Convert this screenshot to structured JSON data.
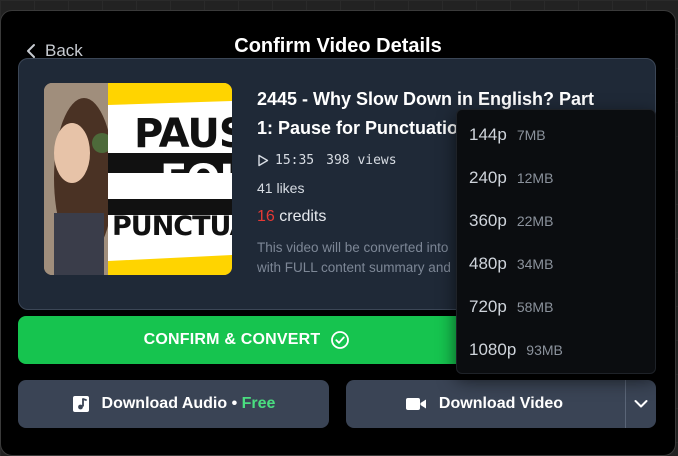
{
  "header": {
    "back_label": "Back",
    "title": "Confirm Video Details"
  },
  "video": {
    "title_line1": "2445 - Why Slow Down in English? Part",
    "title_line2": "1: Pause for Punctuatio",
    "duration": "15:35",
    "views": "398 views",
    "likes": "41 likes",
    "credits_num": "16",
    "credits_label": "credits",
    "desc_line1": "This video will be converted into",
    "desc_line2": "with FULL content summary and",
    "thumbnail_text": [
      "PAUS",
      "FOI",
      "PUNCTUA"
    ]
  },
  "confirm": {
    "label": "CONFIRM & CONVERT"
  },
  "download_audio": {
    "label": "Download Audio",
    "separator": "•",
    "free": "Free"
  },
  "download_video": {
    "label": "Download Video"
  },
  "quality_options": [
    {
      "res": "144p",
      "size": "7MB"
    },
    {
      "res": "240p",
      "size": "12MB"
    },
    {
      "res": "360p",
      "size": "22MB"
    },
    {
      "res": "480p",
      "size": "34MB"
    },
    {
      "res": "720p",
      "size": "58MB"
    },
    {
      "res": "1080p",
      "size": "93MB"
    }
  ],
  "colors": {
    "accent_green": "#16c44f",
    "free_green": "#4ade80",
    "credits_red": "#e53935",
    "card_bg": "#1f2937",
    "button_bg": "#3a4455",
    "thumbnail_yellow": "#ffd400"
  },
  "icons": {
    "back": "chevron-left-icon",
    "play": "play-icon",
    "confirm": "check-circle-icon",
    "audio": "music-note-icon",
    "video": "video-camera-icon",
    "caret": "chevron-down-icon"
  }
}
